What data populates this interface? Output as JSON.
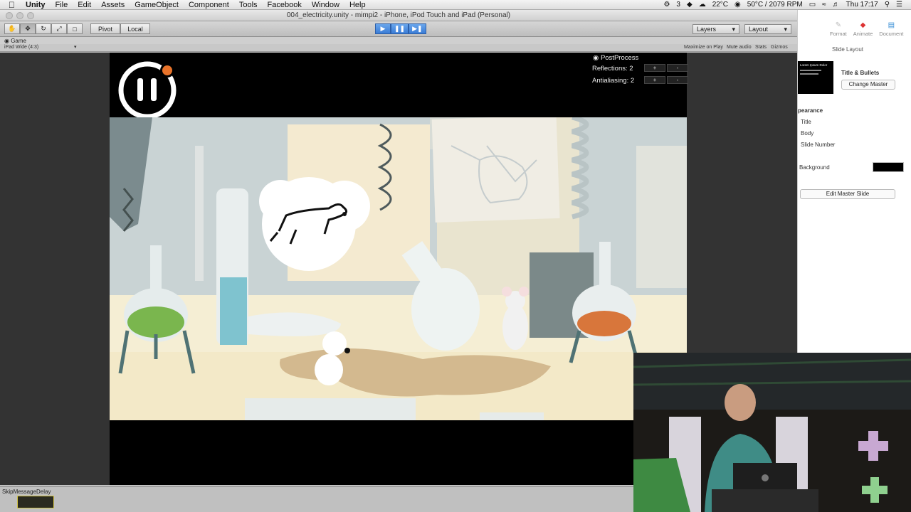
{
  "menubar": {
    "app": "Unity",
    "items": [
      "File",
      "Edit",
      "Assets",
      "GameObject",
      "Component",
      "Tools",
      "Facebook",
      "Window",
      "Help"
    ],
    "status": {
      "notifications": "3",
      "temperature": "22°C",
      "cpu": "50°C / 2079 RPM",
      "clock": "Thu 17:17"
    }
  },
  "window": {
    "title": "004_electricity.unity - mimpi2 - iPhone, iPod Touch and iPad (Personal)"
  },
  "toolbar": {
    "pivot": "Pivot",
    "local": "Local",
    "layers": "Layers",
    "layout": "Layout"
  },
  "game_panel": {
    "tab": "Game",
    "aspect": "iPad Wide (4:3)",
    "maximize": "Maximize on Play",
    "mute": "Mute audio",
    "stats": "Stats",
    "gizmos": "Gizmos"
  },
  "hud": {
    "postprocess": "PostProcess",
    "reflections": "Reflections: 2",
    "antialiasing": "Antialiasing: 2",
    "plus": "+",
    "minus": "-"
  },
  "console": {
    "message": "SkipMessageDelay"
  },
  "keynote": {
    "tabs": [
      "Format",
      "Animate",
      "Document"
    ],
    "heading": "Slide Layout",
    "thumb_text": "Lorem Ipsum Dolor",
    "master_name": "Title & Bullets",
    "change_master": "Change Master",
    "appearance": "pearance",
    "options": [
      "Title",
      "Body",
      "Slide Number"
    ],
    "background_label": "Background",
    "background_color": "#000000",
    "edit_master": "Edit Master Slide"
  },
  "colors": {
    "accent_orange": "#e8732a",
    "play_blue": "#3a7cd6"
  }
}
